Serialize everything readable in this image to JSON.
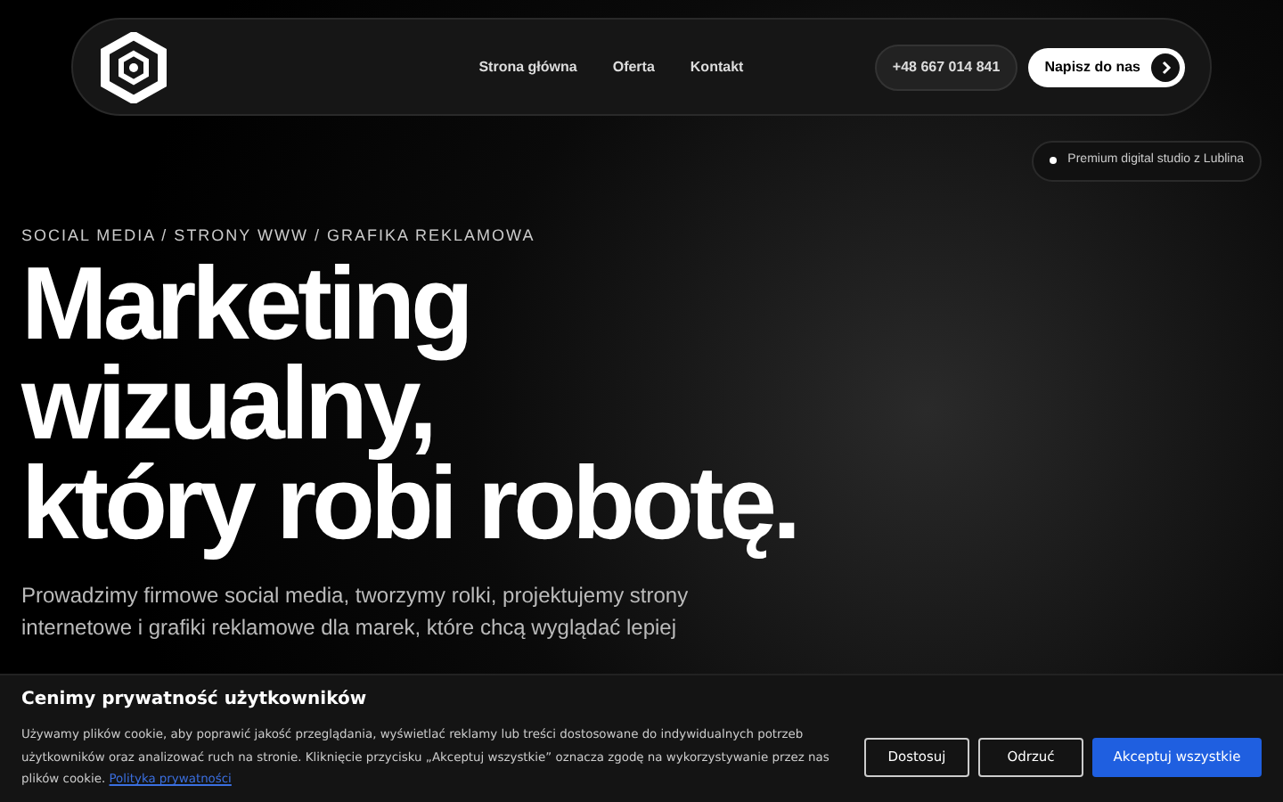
{
  "nav": {
    "links": [
      "Strona główna",
      "Oferta",
      "Kontakt"
    ],
    "phone": "+48 667 014 841",
    "cta": "Napisz do nas"
  },
  "badge": {
    "text": "Premium digital studio z Lublina"
  },
  "hero": {
    "eyebrow": "SOCIAL MEDIA / STRONY WWW / GRAFIKA REKLAMOWA",
    "title": [
      "Marketing",
      "wizualny,",
      "który robi robotę."
    ],
    "lead": [
      "Prowadzimy firmowe social media, tworzymy rolki, projektujemy strony",
      "internetowe i grafiki reklamowe dla marek, które chcą wyglądać lepiej"
    ]
  },
  "cookie": {
    "title": "Cenimy prywatność użytkowników",
    "text": "Używamy plików cookie, aby poprawić jakość przeglądania, wyświetlać reklamy lub treści dostosowane do indywidualnych potrzeb użytkowników oraz analizować ruch na stronie. Kliknięcie przycisku „Akceptuj wszystkie” oznacza zgodę na wykorzystywanie przez nas plików cookie.",
    "link": "Polityka prywatności",
    "buttons": [
      {
        "label": "Dostosuj",
        "kind": "outline"
      },
      {
        "label": "Odrzuć",
        "kind": "outline"
      },
      {
        "label": "Akceptuj wszystkie",
        "kind": "primary"
      }
    ]
  }
}
